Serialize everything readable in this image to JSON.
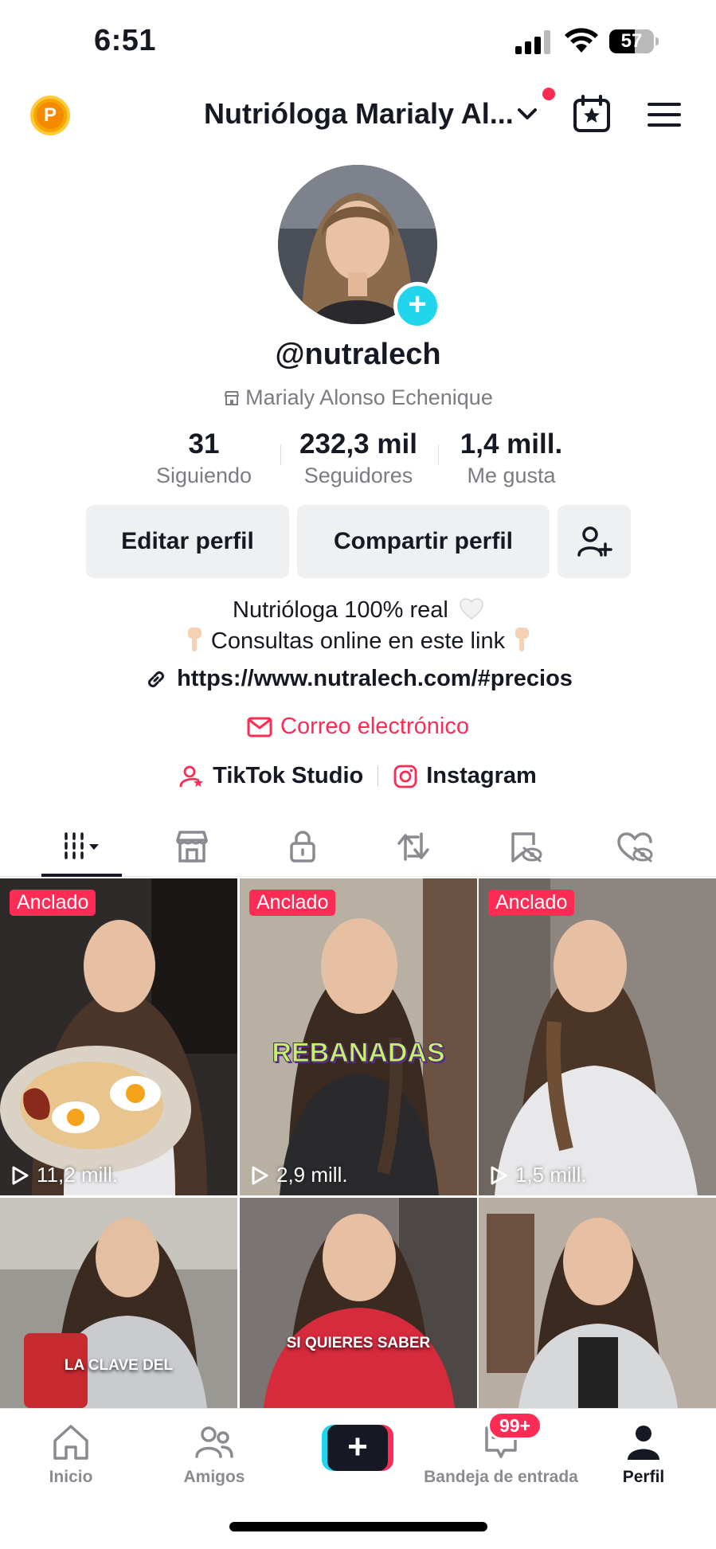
{
  "status_bar": {
    "time": "6:51",
    "battery": "57",
    "battery_level": 0.57
  },
  "header": {
    "account_name": "Nutrióloga Marialy Al...",
    "points_label": "P"
  },
  "profile": {
    "username": "@nutralech",
    "display_name": "Marialy Alonso Echenique",
    "stats": [
      {
        "value": "31",
        "label": "Siguiendo"
      },
      {
        "value": "232,3 mil",
        "label": "Seguidores"
      },
      {
        "value": "1,4 mill.",
        "label": "Me gusta"
      }
    ],
    "buttons": {
      "edit": "Editar perfil",
      "share": "Compartir perfil"
    },
    "bio": {
      "line1": "Nutrióloga 100% real",
      "line2": "Consultas online en este link"
    },
    "link": "https://www.nutralech.com/#precios",
    "email": "Correo electrónico",
    "quick_links": {
      "studio": "TikTok Studio",
      "instagram": "Instagram"
    }
  },
  "tabs": [
    "videos-icon",
    "shop-icon",
    "lock-icon",
    "repost-icon",
    "favorites-hidden-icon",
    "liked-hidden-icon"
  ],
  "grid": {
    "pinned_label": "Anclado",
    "tiles": [
      {
        "pinned": true,
        "views": "11,2 mill.",
        "caption": ""
      },
      {
        "pinned": true,
        "views": "2,9 mill.",
        "caption": "REBANADAS"
      },
      {
        "pinned": true,
        "views": "1,5 mill.",
        "caption": ""
      },
      {
        "pinned": false,
        "views": "",
        "caption": "LA CLAVE DEL"
      },
      {
        "pinned": false,
        "views": "",
        "caption": "SI QUIERES SABER"
      },
      {
        "pinned": false,
        "views": "",
        "caption": ""
      }
    ]
  },
  "bottom_nav": {
    "home": "Inicio",
    "friends": "Amigos",
    "inbox": "Bandeja de entrada",
    "inbox_badge": "99+",
    "profile": "Perfil"
  },
  "colors": {
    "accent": "#fe2c55",
    "cyan": "#20d5ec",
    "text": "#161823",
    "muted": "#7a7c82"
  }
}
